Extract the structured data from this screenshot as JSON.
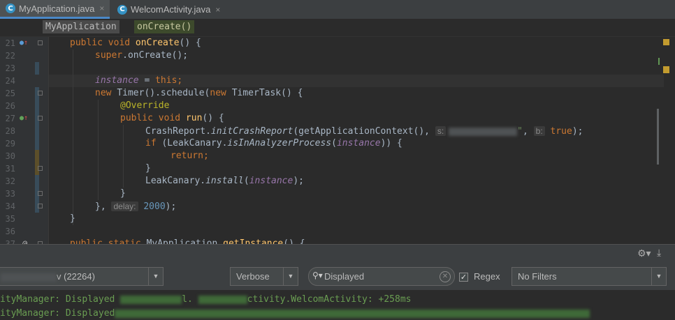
{
  "tabs": [
    {
      "icon": "C",
      "label": "MyApplication.java",
      "close": "×",
      "active": true
    },
    {
      "icon": "C",
      "label": "WelcomActivity.java",
      "close": "×",
      "active": false
    }
  ],
  "breadcrumbs": [
    "MyApplication",
    "onCreate()"
  ],
  "editor": {
    "line_numbers": [
      "21",
      "22",
      "23",
      "24",
      "25",
      "26",
      "27",
      "28",
      "29",
      "30",
      "31",
      "32",
      "33",
      "34",
      "35",
      "36",
      "37"
    ],
    "code": {
      "l21": {
        "kw": "public void ",
        "fn": "onCreate",
        "rest": "() {"
      },
      "l22": {
        "kw": "super",
        "rest": ".onCreate();"
      },
      "l24": {
        "fld": "instance",
        "eq": " = ",
        "kw": "this",
        "rest": ";"
      },
      "l25": {
        "kw1": "new ",
        "mid": "Timer().schedule(",
        "kw2": "new ",
        "rest": "TimerTask() {"
      },
      "l26": {
        "ann": "@Override"
      },
      "l27": {
        "kw": "public void ",
        "fn": "run",
        "rest": "() {"
      },
      "l28": {
        "pre": "CrashReport.",
        "st": "initCrashReport",
        "mid": "(getApplicationContext(), ",
        "hint_s": "s:",
        "q": "\"",
        "comma": ", ",
        "hint_b": "b:",
        "kw": " true",
        "rest": ");"
      },
      "l29": {
        "kw": "if ",
        "pre": "(LeakCanary.",
        "st": "isInAnalyzerProcess",
        "paren": "(",
        "fld": "instance",
        "rest": ")) {"
      },
      "l30": {
        "kw": "return",
        "rest": ";"
      },
      "l31": {
        "text": "}"
      },
      "l32": {
        "pre": "LeakCanary.",
        "st": "install",
        "paren": "(",
        "fld": "instance",
        "rest": ");"
      },
      "l33": {
        "text": "}"
      },
      "l34": {
        "pre": "}, ",
        "hint": "delay:",
        "num": " 2000",
        "rest": ");"
      },
      "l35": {
        "text": "}"
      },
      "l37": {
        "kw": "public static ",
        "type": "MyApplication ",
        "fn": "getInstance",
        "rest": "() {"
      }
    }
  },
  "logcat": {
    "process_value": "v (22264)",
    "level": "Verbose",
    "search_value": "Displayed",
    "regex_label": "Regex",
    "regex_checked": true,
    "filter": "No Filters",
    "lines": [
      {
        "a": "ityManager: Displayed ",
        "b": "l. ",
        "c": "ctivity.WelcomActivity: +258ms"
      },
      {
        "a": "ityManager: Displayed",
        "b": "",
        "c": ""
      }
    ]
  },
  "colors": {
    "keyword": "#cc7832",
    "function": "#ffc66d",
    "field": "#9876aa",
    "annotation": "#bbb529",
    "number": "#6897bb",
    "log_info": "#6a9e52"
  }
}
